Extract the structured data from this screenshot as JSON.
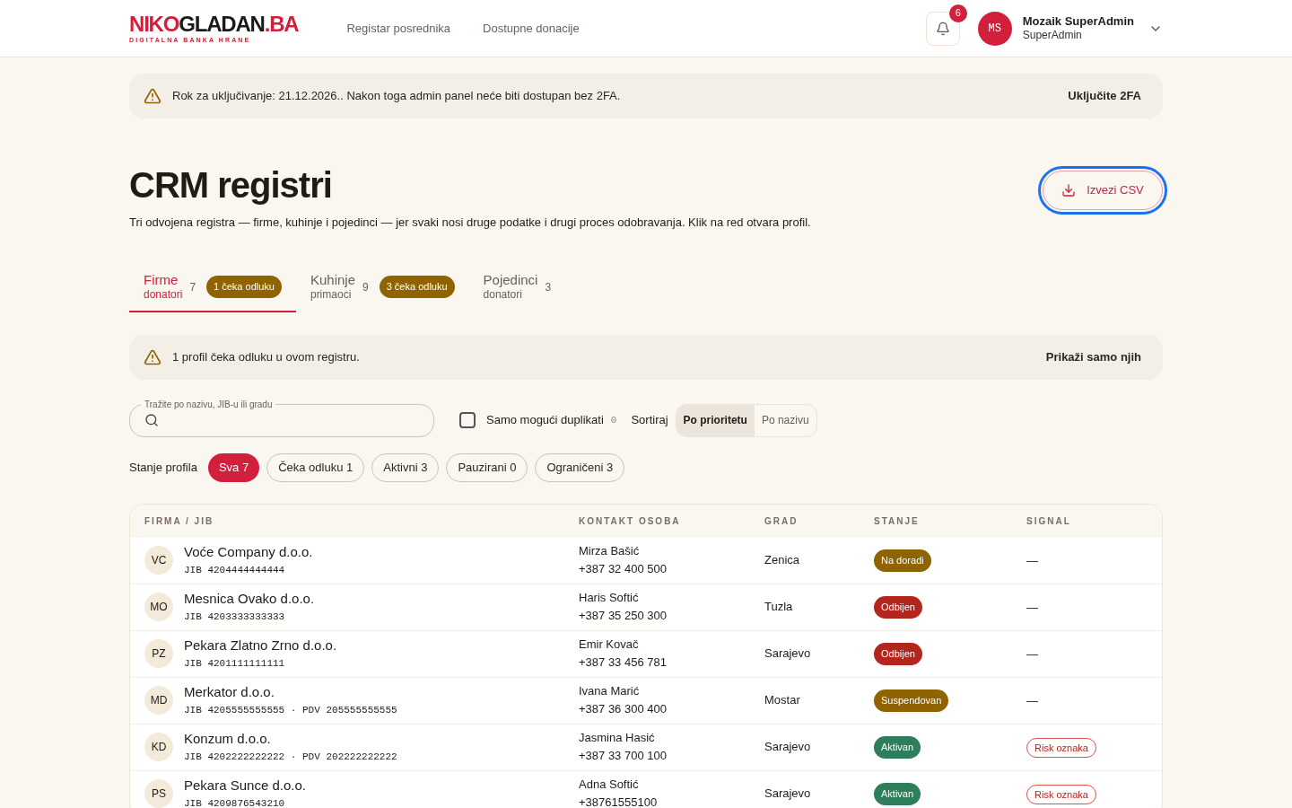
{
  "header": {
    "logo": {
      "parts": [
        {
          "text": "NIKO",
          "kind": "accent"
        },
        {
          "text": "GLADAN",
          "kind": "dark"
        },
        {
          "text": ".BA",
          "kind": "accent"
        }
      ],
      "tagline": "DIGITALNA BANKA HRANE"
    },
    "nav": [
      "Registar posrednika",
      "Dostupne donacije"
    ],
    "notifications": {
      "count": "6"
    },
    "user": {
      "initials": "MS",
      "name": "Mozaik SuperAdmin",
      "role": "SuperAdmin"
    }
  },
  "twofa_banner": {
    "text": "Rok za uključivanje: 21.12.2026.. Nakon toga admin panel neće biti dostupan bez 2FA.",
    "action": "Uključite 2FA"
  },
  "page": {
    "title": "CRM registri",
    "subtitle": "Tri odvojena registra — firme, kuhinje i pojedinci — jer svaki nosi druge podatke i drugi proces odobravanja. Klik na red otvara profil.",
    "export": {
      "label": "Izvezi CSV",
      "focused": true
    }
  },
  "tabs": [
    {
      "label": "Firme",
      "sublabel": "donatori",
      "count": "7",
      "badge": "1 čeka odluku",
      "selected": true
    },
    {
      "label": "Kuhinje",
      "sublabel": "primaoci",
      "count": "9",
      "badge": "3 čeka odluku",
      "selected": false
    },
    {
      "label": "Pojedinci",
      "sublabel": "donatori",
      "count": "3",
      "selected": false
    }
  ],
  "pending_banner": {
    "text": "1 profil čeka odluku u ovom registru.",
    "action": "Prikaži samo njih"
  },
  "filters": {
    "search": {
      "label": "Tražite po nazivu, JIB-u ili gradu"
    },
    "duplicates": {
      "label": "Samo mogući duplikati",
      "count": "0",
      "checked": false
    },
    "sort": {
      "label": "Sortiraj",
      "options": [
        {
          "label": "Po prioritetu",
          "selected": true
        },
        {
          "label": "Po nazivu",
          "selected": false
        }
      ]
    },
    "state": {
      "label": "Stanje profila",
      "chips": [
        {
          "label": "Sva 7",
          "selected": true
        },
        {
          "label": "Čeka odluku 1",
          "selected": false
        },
        {
          "label": "Aktivni 3",
          "selected": false
        },
        {
          "label": "Pauzirani 0",
          "selected": false
        },
        {
          "label": "Ograničeni 3",
          "selected": false
        }
      ]
    }
  },
  "table": {
    "columns": [
      "FIRMA / JIB",
      "KONTAKT OSOBA",
      "GRAD",
      "STANJE",
      "SIGNAL"
    ],
    "rows": [
      {
        "initials": "VC",
        "name": "Voće Company d.o.o.",
        "ids": "JIB 4204444444444",
        "contact": "Mirza Bašić",
        "phone": "+387 32 400 500",
        "city": "Zenica",
        "status": {
          "label": "Na doradi",
          "color": "#8f6400"
        },
        "signal": {
          "kind": "none",
          "text": "—"
        }
      },
      {
        "initials": "MO",
        "name": "Mesnica Ovako d.o.o.",
        "ids": "JIB 4203333333333",
        "contact": "Haris Softić",
        "phone": "+387 35 250 300",
        "city": "Tuzla",
        "status": {
          "label": "Odbijen",
          "color": "#b3261e"
        },
        "signal": {
          "kind": "none",
          "text": "—"
        }
      },
      {
        "initials": "PZ",
        "name": "Pekara Zlatno Zrno d.o.o.",
        "ids": "JIB 4201111111111",
        "contact": "Emir Kovač",
        "phone": "+387 33 456 781",
        "city": "Sarajevo",
        "status": {
          "label": "Odbijen",
          "color": "#b3261e"
        },
        "signal": {
          "kind": "none",
          "text": "—"
        }
      },
      {
        "initials": "MD",
        "name": "Merkator d.o.o.",
        "ids": "JIB 4205555555555 · PDV 205555555555",
        "contact": "Ivana Marić",
        "phone": "+387 36 300 400",
        "city": "Mostar",
        "status": {
          "label": "Suspendovan",
          "color": "#8f6400"
        },
        "signal": {
          "kind": "none",
          "text": "—"
        }
      },
      {
        "initials": "KD",
        "name": "Konzum d.o.o.",
        "ids": "JIB 4202222222222 · PDV 202222222222",
        "contact": "Jasmina Hasić",
        "phone": "+387 33 700 100",
        "city": "Sarajevo",
        "status": {
          "label": "Aktivan",
          "color": "#2e7d5b"
        },
        "signal": {
          "kind": "risk",
          "text": "Risk oznaka"
        }
      },
      {
        "initials": "PS",
        "name": "Pekara Sunce d.o.o.",
        "ids": "JIB 4209876543210",
        "contact": "Adna Softić",
        "phone": "+38761555100",
        "city": "Sarajevo",
        "status": {
          "label": "Aktivan",
          "color": "#2e7d5b"
        },
        "signal": {
          "kind": "risk",
          "text": "Risk oznaka"
        }
      }
    ]
  }
}
